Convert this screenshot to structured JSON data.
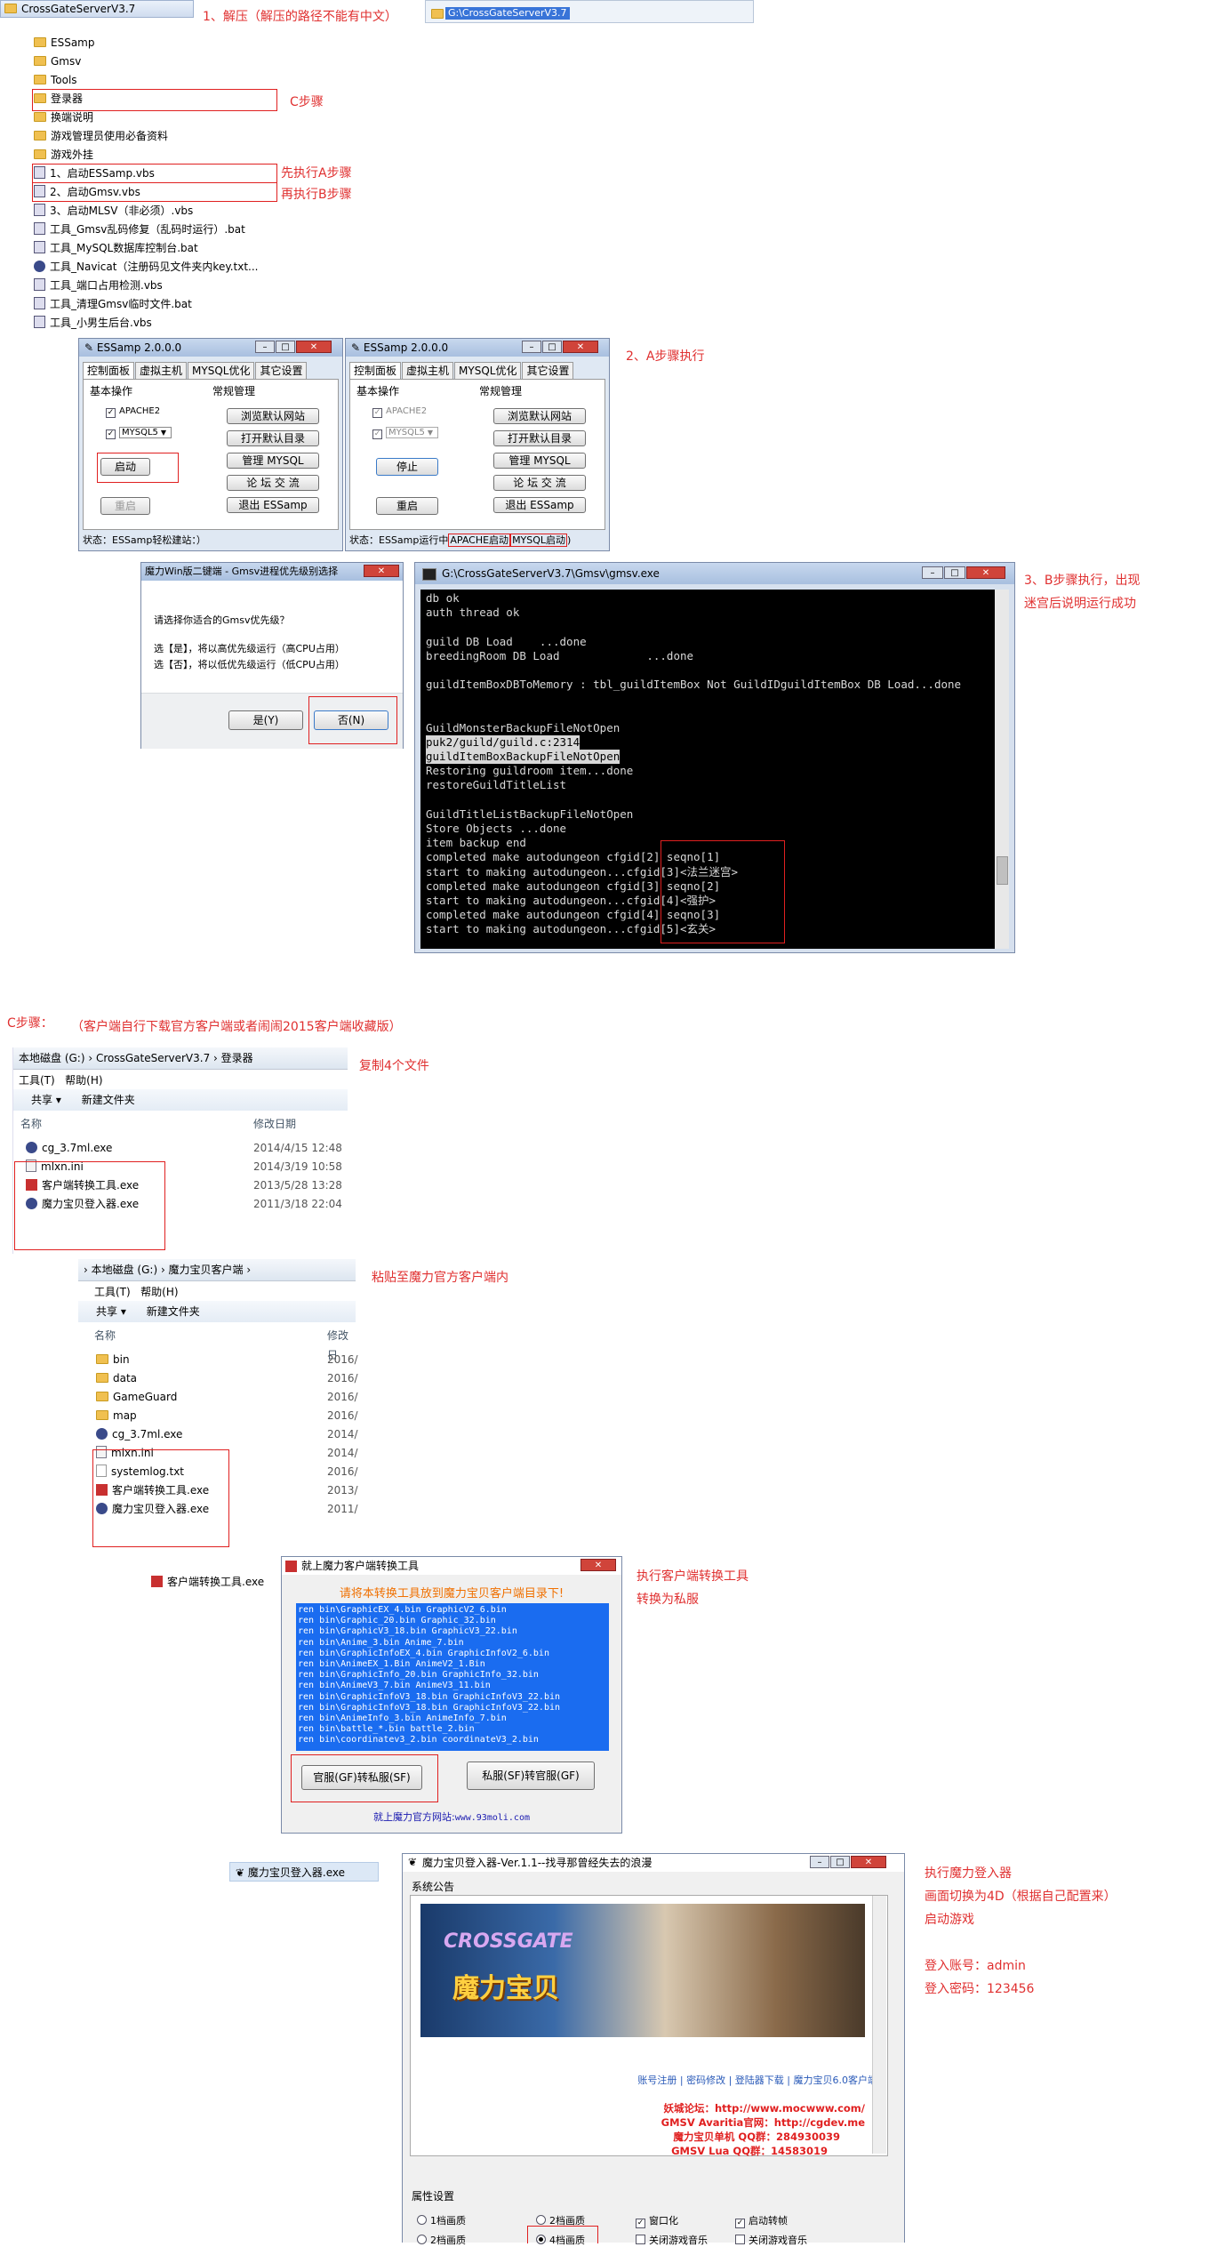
{
  "step1": {
    "annotation": "1、解压（解压的路径不能有中文）",
    "folder_title": "CrossGateServerV3.7",
    "address_path": "G:\\CrossGateServerV3.7",
    "files": [
      {
        "name": "ESSamp",
        "icon": "folder-icon"
      },
      {
        "name": "Gmsv",
        "icon": "folder-icon"
      },
      {
        "name": "Tools",
        "icon": "folder-icon"
      },
      {
        "name": "登录器",
        "icon": "folder-icon"
      },
      {
        "name": "换端说明",
        "icon": "folder-icon"
      },
      {
        "name": "游戏管理员使用必备资料",
        "icon": "folder-icon"
      },
      {
        "name": "游戏外挂",
        "icon": "folder-icon"
      },
      {
        "name": "1、启动ESSamp.vbs",
        "icon": "vbs-icon"
      },
      {
        "name": "2、启动Gmsv.vbs",
        "icon": "vbs-icon"
      },
      {
        "name": "3、启动MLSV（非必须）.vbs",
        "icon": "vbs-icon"
      },
      {
        "name": "工具_Gmsv乱码修复（乱码时运行）.bat",
        "icon": "bat-icon"
      },
      {
        "name": "工具_MySQL数据库控制台.bat",
        "icon": "bat-icon"
      },
      {
        "name": "工具_Navicat（注册码见文件夹内key.txt...",
        "icon": "exe-icon"
      },
      {
        "name": "工具_端口占用检测.vbs",
        "icon": "vbs-icon"
      },
      {
        "name": "工具_清理Gmsv临时文件.bat",
        "icon": "bat-icon"
      },
      {
        "name": "工具_小男生后台.vbs",
        "icon": "vbs-icon"
      }
    ],
    "note_c": "C步骤",
    "note_a": "先执行A步骤",
    "note_b": "再执行B步骤"
  },
  "step2": {
    "annotation": "2、A步骤执行",
    "essamp": {
      "title": "ESSamp 2.0.0.0",
      "tabs": [
        "控制面板",
        "虚拟主机",
        "MYSQL优化",
        "其它设置"
      ],
      "group_basic": "基本操作",
      "group_common": "常规管理",
      "apache": "APACHE2",
      "mysql": "MYSQL5",
      "start": "启动",
      "stop": "停止",
      "restart": "重启",
      "browse_site": "浏览默认网站",
      "open_dir": "打开默认目录",
      "manage_mysql": "管理  MYSQL",
      "forum": "论 坛 交 流",
      "exit": "退出  ESSamp",
      "status_idle": "状态：ESSamp轻松建站：）",
      "status_running": "状态：ESSamp运行中",
      "status_apache": "APACHE启动",
      "status_mysql": "MYSQL启动",
      "status_close": ")"
    }
  },
  "step3": {
    "annotation_line1": "3、B步骤执行，出现",
    "annotation_line2": "迷宫后说明运行成功",
    "dialog": {
      "title": "魔力Win版二键端 - Gmsv进程优先级别选择",
      "question": "请选择你适合的Gmsv优先级？",
      "line1": "选【是】，将以高优先级运行（高CPU占用）",
      "line2": "选【否】，将以低优先级运行（低CPU占用）",
      "yes": "是(Y)",
      "no": "否(N)"
    },
    "console": {
      "title": "G:\\CrossGateServerV3.7\\Gmsv\\gmsv.exe",
      "lines": [
        "db ok",
        "auth thread ok",
        "",
        "guild DB Load    ...done",
        "breedingRoom DB Load             ...done",
        "",
        "guildItemBoxDBToMemory : tbl_guildItemBox Not GuildIDguildItemBox DB Load...done",
        "",
        "",
        "GuildMonsterBackupFileNotOpen",
        "puk2/guild/guild.c:2314",
        "guildItemBoxBackupFileNotOpen",
        "Restoring guildroom item...done",
        "restoreGuildTitleList",
        "",
        "GuildTitleListBackupFileNotOpen",
        "Store Objects ...done",
        "item backup end",
        "completed make autodungeon cfgid[2] seqno[1]",
        "start to making autodungeon...cfgid[3]<法兰迷宫>",
        "completed make autodungeon cfgid[3] seqno[2]",
        "start to making autodungeon...cfgid[4]<强护>",
        "completed make autodungeon cfgid[4] seqno[3]",
        "start to making autodungeon...cfgid[5]<玄关>"
      ]
    }
  },
  "stepC": {
    "heading": "C步骤：",
    "heading_note": "（客户端自行下载官方客户端或者闹闹2015客户端收藏版）",
    "copy_note": "复制4个文件",
    "paste_note": "粘贴至魔力官方客户端内",
    "explorer1": {
      "crumb": "本地磁盘 (G:)  ›  CrossGateServerV3.7  ›  登录器",
      "menu": [
        "工具(T)",
        "帮助(H)"
      ],
      "toolbar": [
        "共享 ▾",
        "新建文件夹"
      ],
      "col_name": "名称",
      "col_date": "修改日期",
      "files": [
        {
          "name": "cg_3.7ml.exe",
          "date": "2014/4/15 12:48",
          "icon": "exe-icon"
        },
        {
          "name": "mlxn.ini",
          "date": "2014/3/19 10:58",
          "icon": "ini-icon"
        },
        {
          "name": "客户端转换工具.exe",
          "date": "2013/5/28 13:28",
          "icon": "exe2-icon"
        },
        {
          "name": "魔力宝贝登入器.exe",
          "date": "2011/3/18 22:04",
          "icon": "exe-icon"
        }
      ]
    },
    "explorer2": {
      "crumb": "›  本地磁盘 (G:)  ›  魔力宝贝客户端  ›",
      "menu": [
        "工具(T)",
        "帮助(H)"
      ],
      "toolbar": [
        "共享 ▾",
        "新建文件夹"
      ],
      "col_name": "名称",
      "col_date": "修改日",
      "files": [
        {
          "name": "bin",
          "date": "2016/",
          "icon": "folder-icon"
        },
        {
          "name": "data",
          "date": "2016/",
          "icon": "folder-icon"
        },
        {
          "name": "GameGuard",
          "date": "2016/",
          "icon": "folder-icon"
        },
        {
          "name": "map",
          "date": "2016/",
          "icon": "folder-icon"
        },
        {
          "name": "cg_3.7ml.exe",
          "date": "2014/",
          "icon": "exe-icon"
        },
        {
          "name": "mlxn.ini",
          "date": "2014/",
          "icon": "ini-icon"
        },
        {
          "name": "systemlog.txt",
          "date": "2016/",
          "icon": "txt-icon"
        },
        {
          "name": "客户端转换工具.exe",
          "date": "2013/",
          "icon": "exe2-icon"
        },
        {
          "name": "魔力宝贝登入器.exe",
          "date": "2011/",
          "icon": "exe-icon"
        }
      ]
    },
    "converter": {
      "shortcut": "客户端转换工具.exe",
      "title": "就上魔力客户端转换工具",
      "warning": "请将本转换工具放到魔力宝贝客户端目录下!",
      "commands": [
        "ren bin\\GraphicEX_4.bin GraphicV2_6.bin",
        "ren bin\\Graphic_20.bin Graphic_32.bin",
        "ren bin\\GraphicV3_18.bin GraphicV3_22.bin",
        "ren bin\\Anime_3.bin Anime_7.bin",
        "ren bin\\GraphicInfoEX_4.bin GraphicInfoV2_6.bin",
        "ren bin\\AnimeEX_1.Bin AnimeV2_1.Bin",
        "ren bin\\GraphicInfo_20.bin GraphicInfo_32.bin",
        "ren bin\\AnimeV3_7.bin AnimeV3_11.bin",
        "ren bin\\GraphicInfoV3_18.bin GraphicInfoV3_22.bin",
        "ren bin\\GraphicInfoV3_18.bin GraphicInfoV3_22.bin",
        "ren bin\\AnimeInfo_3.bin AnimeInfo_7.bin",
        "ren bin\\battle_*.bin battle_2.bin",
        "ren bin\\coordinatev3_2.bin coordinateV3_2.bin"
      ],
      "to_private": "官服(GF)转私服(SF)",
      "to_official": "私服(SF)转官服(GF)",
      "site_label": "就上魔力官方网站:",
      "site_url": "www.93moli.com",
      "note_line1": "执行客户端转换工具",
      "note_line2": "转换为私服"
    },
    "launcher": {
      "shortcut": "魔力宝贝登入器.exe",
      "title": "魔力宝贝登入器-Ver.1.1--找寻那曾经失去的浪漫",
      "group_announce": "系统公告",
      "banner_text": "CROSSGATE",
      "banner_sub": "魔力宝贝",
      "links": [
        "账号注册",
        "密码修改",
        "登陆器下载",
        "魔力宝贝6.0客户端"
      ],
      "forum": "妖城论坛：http://www.mocwww.com/",
      "gmsv_site": "GMSV Avaritia官网：http://cgdev.me",
      "qq1": "魔力宝贝单机 QQ群：284930039",
      "qq2": "GMSV Lua QQ群：14583019",
      "group_props": "属性设置",
      "options": [
        "1档画质",
        "2档画质",
        "窗口化",
        "启动转帧",
        "2档画质",
        "4档画质",
        "关闭游戏音乐",
        "关闭游戏音乐"
      ],
      "note_line1": "执行魔力登入器",
      "note_line2": "画面切换为4D（根据自己配置来）",
      "note_line3": "启动游戏",
      "account_label": "登入账号：admin",
      "password_label": "登入密码：123456"
    }
  }
}
